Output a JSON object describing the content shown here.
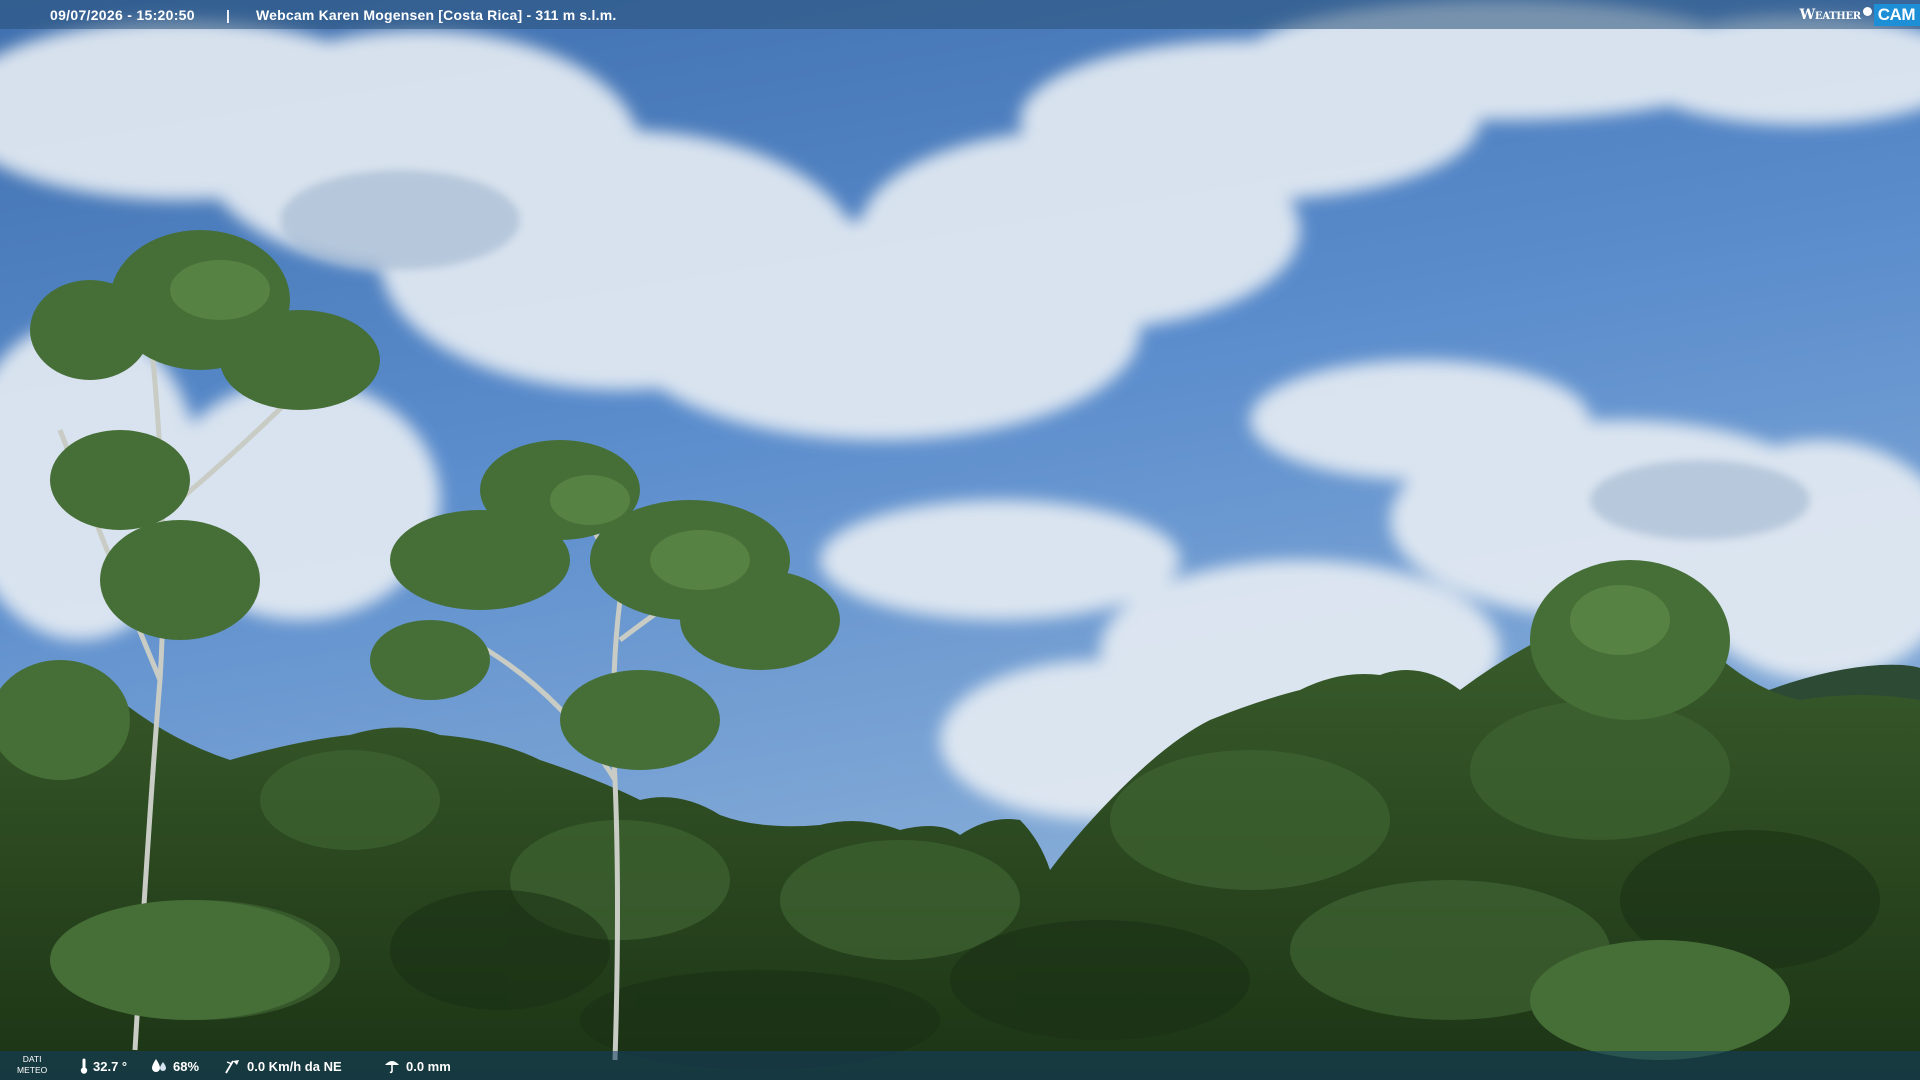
{
  "top_bar": {
    "datetime": "09/07/2026 - 15:20:50",
    "separator": "|",
    "title": "Webcam Karen Mogensen [Costa Rica]  -  311 m s.l.m."
  },
  "brand": {
    "weather_text": "Weather",
    "cam_text": "CAM",
    "accent_color": "#1d8fd6"
  },
  "meteo": {
    "caption_line1": "DATI",
    "caption_line2": "METEO",
    "temperature": "32.7 °",
    "humidity": "68%",
    "wind": "0.0 Km/h da NE",
    "rain": "0.0 mm",
    "icons": [
      "thermometer-icon",
      "humidity-drop-icon",
      "wind-vane-icon",
      "rain-gauge-icon"
    ]
  },
  "scene": {
    "subject": "Tropical forest canopy under a partly cloudy blue sky",
    "sky_color": "#4f7fbf",
    "foliage_color": "#2b4a23"
  }
}
